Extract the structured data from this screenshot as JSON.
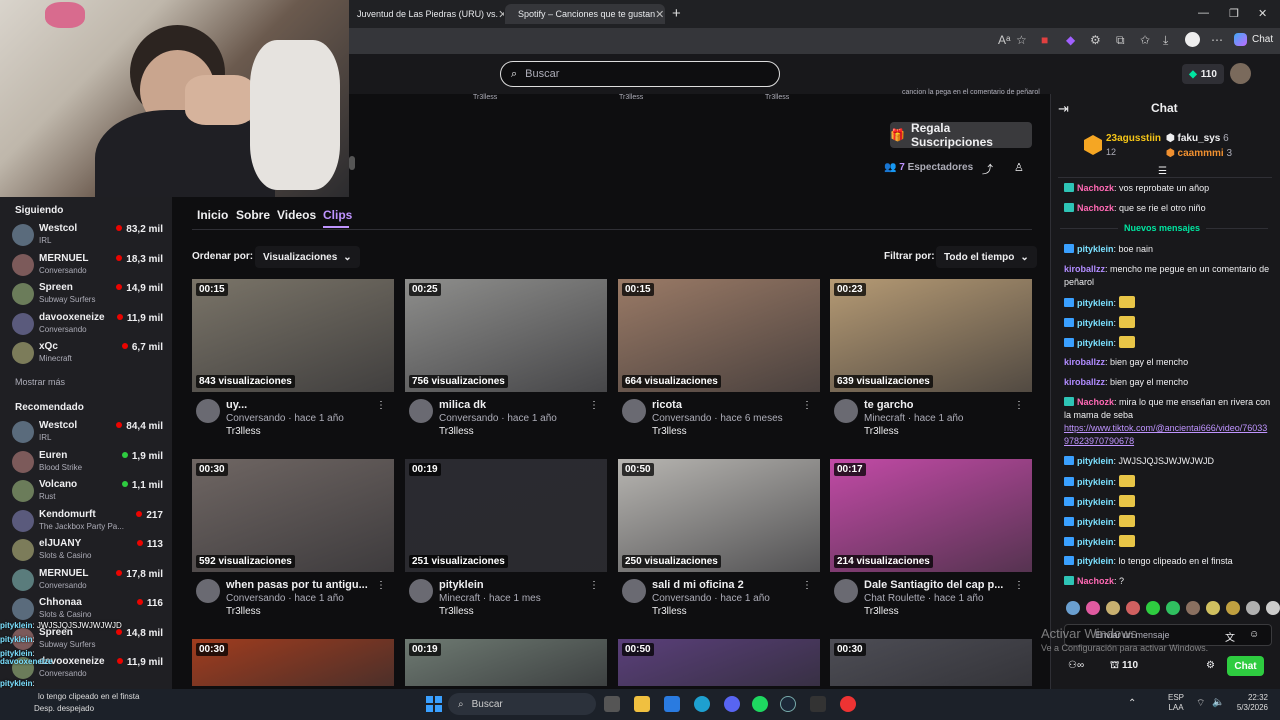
{
  "browser": {
    "tabs": [
      {
        "label": "Juventud de Las Piedras (URU) vs."
      },
      {
        "label": "Spotify – Canciones que te gustan"
      }
    ],
    "new_tab_label": "+",
    "chat_button": "Chat"
  },
  "topnav": {
    "search_placeholder": "Buscar",
    "coins": "110"
  },
  "clip_labels": [
    "Tr3lless",
    "Tr3lless",
    "Tr3lless",
    "cancion la pega en el comentario de peñarol"
  ],
  "channel": {
    "gift_button": "Regala Suscripciones",
    "spectators_count": "7",
    "spectators_label": "Espectadores",
    "number": "12"
  },
  "nav_tabs": [
    "Inicio",
    "Sobre",
    "Videos",
    "Clips"
  ],
  "sort": {
    "label": "Ordenar por:",
    "value": "Visualizaciones"
  },
  "filter": {
    "label": "Filtrar por:",
    "value": "Todo el tiempo"
  },
  "sidebar": {
    "following_title": "Siguiendo",
    "following": [
      {
        "name": "Westcol",
        "category": "IRL",
        "viewers": "83,2 mil"
      },
      {
        "name": "MERNUEL",
        "category": "Conversando",
        "viewers": "18,3 mil"
      },
      {
        "name": "Spreen",
        "category": "Subway Surfers",
        "viewers": "14,9 mil"
      },
      {
        "name": "davooxeneize",
        "category": "Conversando",
        "viewers": "11,9 mil"
      },
      {
        "name": "xQc",
        "category": "Minecraft",
        "viewers": "6,7 mil"
      }
    ],
    "show_more": "Mostrar más",
    "recommended_title": "Recomendado",
    "recommended": [
      {
        "name": "Westcol",
        "category": "IRL",
        "viewers": "84,4 mil"
      },
      {
        "name": "Euren",
        "category": "Blood Strike",
        "viewers": "1,9 mil"
      },
      {
        "name": "Volcano",
        "category": "Rust",
        "viewers": "1,1 mil"
      },
      {
        "name": "Kendomurft",
        "category": "The Jackbox Party Pa...",
        "viewers": "217"
      },
      {
        "name": "elJUANY",
        "category": "Slots & Casino",
        "viewers": "113"
      },
      {
        "name": "MERNUEL",
        "category": "Conversando",
        "viewers": "17,8 mil"
      },
      {
        "name": "Chhonaa",
        "category": "Slots & Casino",
        "viewers": "116"
      },
      {
        "name": "Spreen",
        "category": "Subway Surfers",
        "viewers": "14,8 mil"
      },
      {
        "name": "davooxeneize",
        "category": "Conversando",
        "viewers": "11,9 mil"
      }
    ]
  },
  "clips": [
    {
      "duration": "00:15",
      "views": "843 visualizaciones",
      "title": "uy...",
      "sub": "Conversando · hace 1 año",
      "channel": "Tr3lless",
      "color": "#7a7468"
    },
    {
      "duration": "00:25",
      "views": "756 visualizaciones",
      "title": "milica dk",
      "sub": "Conversando · hace 1 año",
      "channel": "Tr3lless",
      "color": "#8e8e8c"
    },
    {
      "duration": "00:15",
      "views": "664 visualizaciones",
      "title": "ricota",
      "sub": "Conversando · hace 6 meses",
      "channel": "Tr3lless",
      "color": "#9a7a66"
    },
    {
      "duration": "00:23",
      "views": "639 visualizaciones",
      "title": "te garcho",
      "sub": "Minecraft · hace 1 año",
      "channel": "Tr3lless",
      "color": "#b59a74"
    },
    {
      "duration": "00:30",
      "views": "592 visualizaciones",
      "title": "when pasas por tu antigu...",
      "sub": "Conversando · hace 1 año",
      "channel": "Tr3lless",
      "color": "#6f6663"
    },
    {
      "duration": "00:19",
      "views": "251 visualizaciones",
      "title": "pityklein",
      "sub": "Minecraft · hace 1 mes",
      "channel": "Tr3lless",
      "color": "#2a2a30"
    },
    {
      "duration": "00:50",
      "views": "250 visualizaciones",
      "title": "sali d mi oficina 2",
      "sub": "Conversando · hace 1 año",
      "channel": "Tr3lless",
      "color": "#b7b5b1"
    },
    {
      "duration": "00:17",
      "views": "214 visualizaciones",
      "title": "Dale Santiagito del cap p...",
      "sub": "Chat Roulette · hace 1 año",
      "channel": "Tr3lless",
      "color": "#c24aa6"
    },
    {
      "duration": "00:30",
      "color": "#a03c1e"
    },
    {
      "duration": "00:19",
      "color": "#6e7a72"
    },
    {
      "duration": "00:50",
      "color": "#5a3f7a"
    },
    {
      "duration": "00:30",
      "color": "#4d4d55"
    }
  ],
  "chat": {
    "title": "Chat",
    "leaders": [
      {
        "name": "23agusstiin",
        "count": "12"
      },
      {
        "name": "faku_sys",
        "count": "6"
      },
      {
        "name": "caammmi",
        "count": "3"
      }
    ],
    "new_messages": "Nuevos mensajes",
    "messages": [
      {
        "user": "Nachozk",
        "text": ": vos reprobate un añop",
        "color": "#ff69b4"
      },
      {
        "user": "Nachozk",
        "text": ": que se rie el otro niño",
        "color": "#ff69b4"
      },
      {
        "user": "pityklein",
        "text": ": boe nain",
        "color": "#7be0ff"
      },
      {
        "user": "kiroballzz",
        "text": ": mencho me pegue en un comentario de peñarol",
        "color": "#b18cff"
      },
      {
        "user": "pityklein",
        "text": ":",
        "color": "#7be0ff",
        "emote": true
      },
      {
        "user": "pityklein",
        "text": ":",
        "color": "#7be0ff",
        "emote": true
      },
      {
        "user": "pityklein",
        "text": ":",
        "color": "#7be0ff",
        "emote": true
      },
      {
        "user": "kiroballzz",
        "text": ": bien gay el mencho",
        "color": "#b18cff"
      },
      {
        "user": "kiroballzz",
        "text": ": bien gay el mencho",
        "color": "#b18cff"
      },
      {
        "user": "Nachozk",
        "text": ": mira lo que me enseñan en rivera con la mama de seba",
        "color": "#ff69b4"
      },
      {
        "user": "pityklein",
        "text": ": JWJSJQJSJWJWJWJD",
        "color": "#7be0ff"
      },
      {
        "user": "pityklein",
        "text": ":",
        "color": "#7be0ff",
        "emote": true
      },
      {
        "user": "pityklein",
        "text": ":",
        "color": "#7be0ff",
        "emote": true
      },
      {
        "user": "pityklein",
        "text": ":",
        "color": "#7be0ff",
        "emote": true
      },
      {
        "user": "pityklein",
        "text": ":",
        "color": "#7be0ff",
        "emote": true
      },
      {
        "user": "pityklein",
        "text": ": lo tengo clipeado en el finsta",
        "color": "#7be0ff"
      },
      {
        "user": "Nachozk",
        "text": ": ?",
        "color": "#ff69b4"
      }
    ],
    "link": "https://www.tiktok.com/@ancientai666/video/7603397823970790678",
    "input_placeholder": "Enviar un mensaje",
    "points": "110",
    "send_button": "Chat",
    "activate_line1": "Activar Windows",
    "activate_line2": "Ve a Configuración para activar Windows."
  },
  "overlay": [
    {
      "user": "pityklein",
      "text": ": JWJSJQJSJWJWJWJD"
    },
    {
      "user": "pityklein",
      "text": ":"
    },
    {
      "user": "pityklein",
      "text": ":"
    },
    {
      "user": "davooxeneize",
      "text": ""
    },
    {
      "user": "pityklein",
      "text": ":"
    },
    {
      "user": "Nachozk",
      "text": ": ?"
    }
  ],
  "taskbar": {
    "weather": "Desp. despejado",
    "weather_clip": "lo tengo clipeado en el finsta",
    "search": "Buscar",
    "lang1": "ESP",
    "lang2": "LAA",
    "time": "22:32",
    "date": "5/3/2026"
  }
}
